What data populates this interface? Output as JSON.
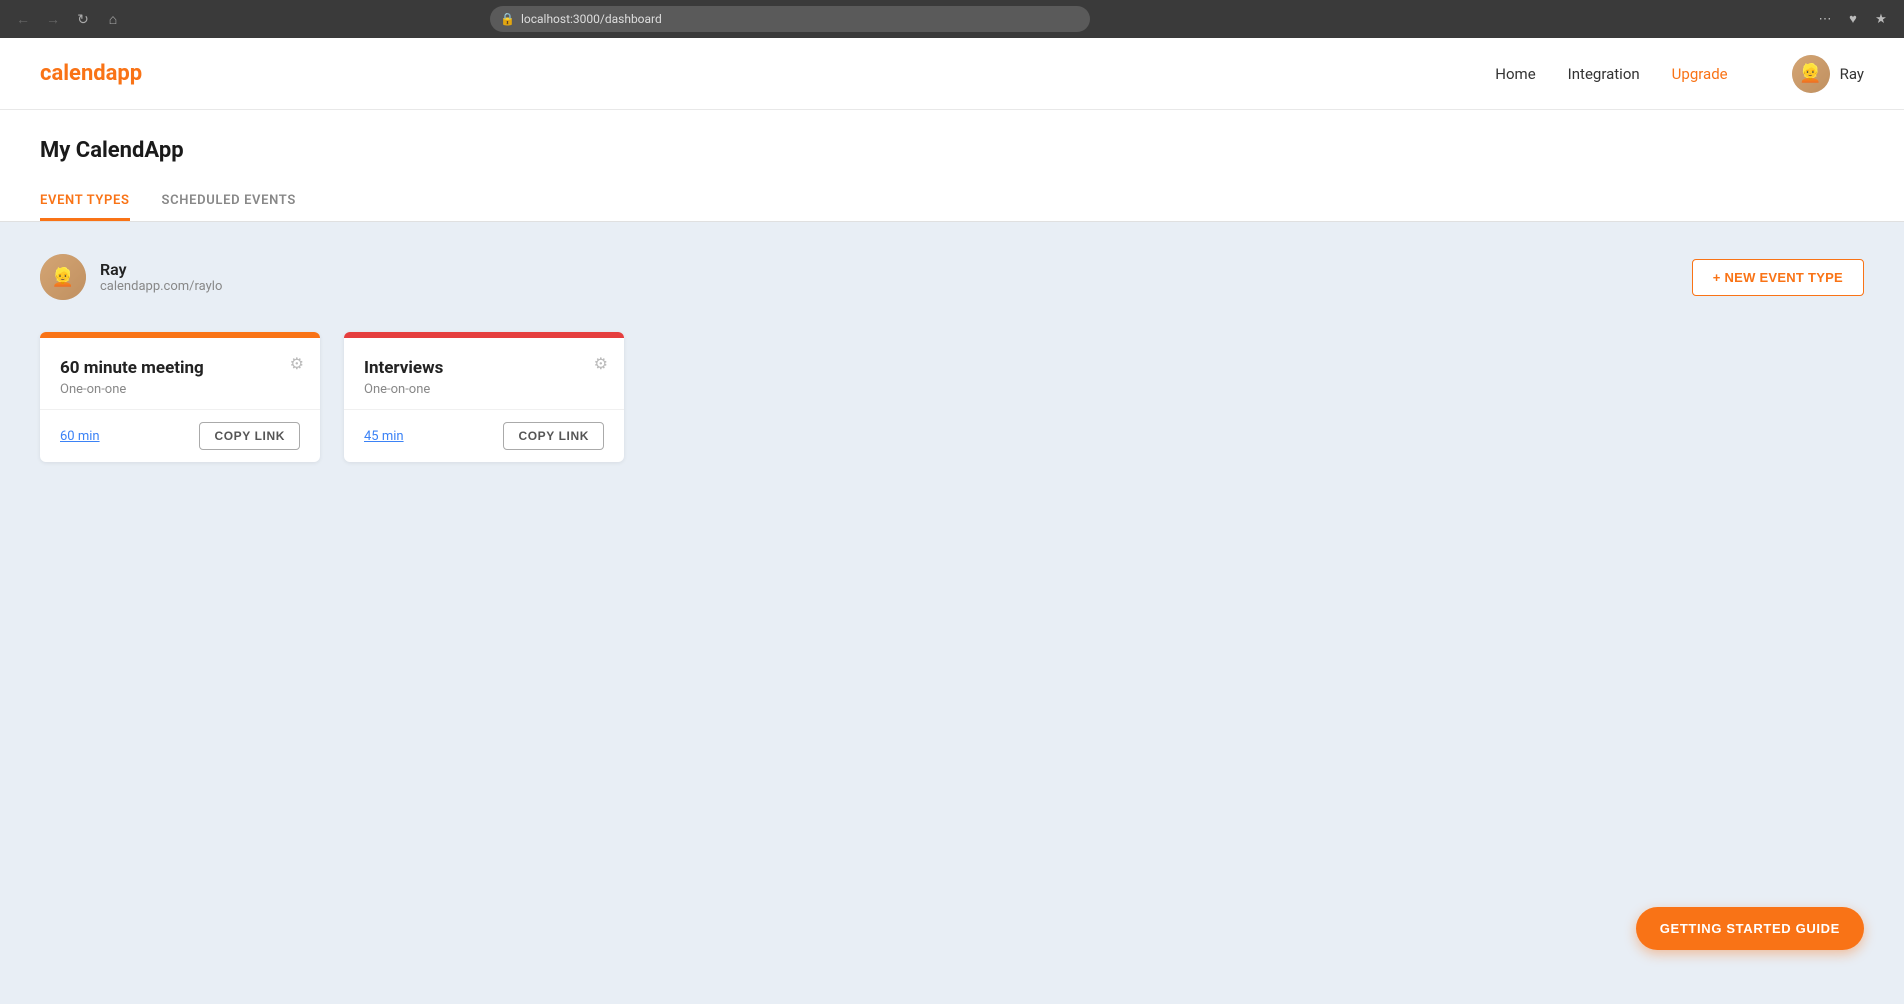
{
  "browser": {
    "url": "localhost:3000/dashboard",
    "nav": {
      "back_disabled": true,
      "forward_disabled": true
    }
  },
  "header": {
    "logo_prefix": "calend",
    "logo_suffix": "app",
    "nav": {
      "home": "Home",
      "integration": "Integration",
      "upgrade": "Upgrade"
    },
    "user": {
      "name": "Ray"
    }
  },
  "page": {
    "title": "My CalendApp",
    "tabs": [
      {
        "id": "event-types",
        "label": "EVENT TYPES",
        "active": true
      },
      {
        "id": "scheduled-events",
        "label": "SCHEDULED EVENTS",
        "active": false
      }
    ]
  },
  "user_section": {
    "name": "Ray",
    "url": "calendapp.com/raylo",
    "new_event_button": "+ NEW EVENT TYPE"
  },
  "event_cards": [
    {
      "id": "card-1",
      "color": "orange",
      "title": "60 minute meeting",
      "type": "One-on-one",
      "duration": "60 min",
      "copy_label": "COPY LINK"
    },
    {
      "id": "card-2",
      "color": "red",
      "title": "Interviews",
      "type": "One-on-one",
      "duration": "45 min",
      "copy_label": "COPY LINK"
    }
  ],
  "getting_started": {
    "label": "GETTING STARTED GUIDE"
  }
}
